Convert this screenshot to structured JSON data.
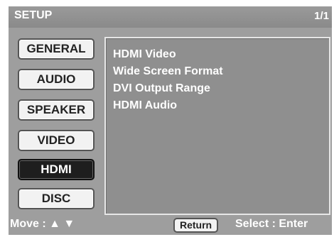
{
  "header": {
    "title": "SETUP",
    "page": "1/1"
  },
  "menu": [
    {
      "label": "GENERAL",
      "active": false
    },
    {
      "label": "AUDIO",
      "active": false
    },
    {
      "label": "SPEAKER",
      "active": false
    },
    {
      "label": "VIDEO",
      "active": false
    },
    {
      "label": "HDMI",
      "active": true
    },
    {
      "label": "DISC",
      "active": false
    }
  ],
  "panel": {
    "items": [
      "HDMI Video",
      "Wide Screen Format",
      "DVI Output Range",
      "HDMI Audio"
    ]
  },
  "footer": {
    "move": "Move : ▲ ▼",
    "return_label": "Return",
    "select": "Select :  Enter"
  },
  "colors": {
    "screen_bg": "#9e9e9e",
    "active_button": "#1e1e1e",
    "button_bg": "#f2f2f2"
  }
}
